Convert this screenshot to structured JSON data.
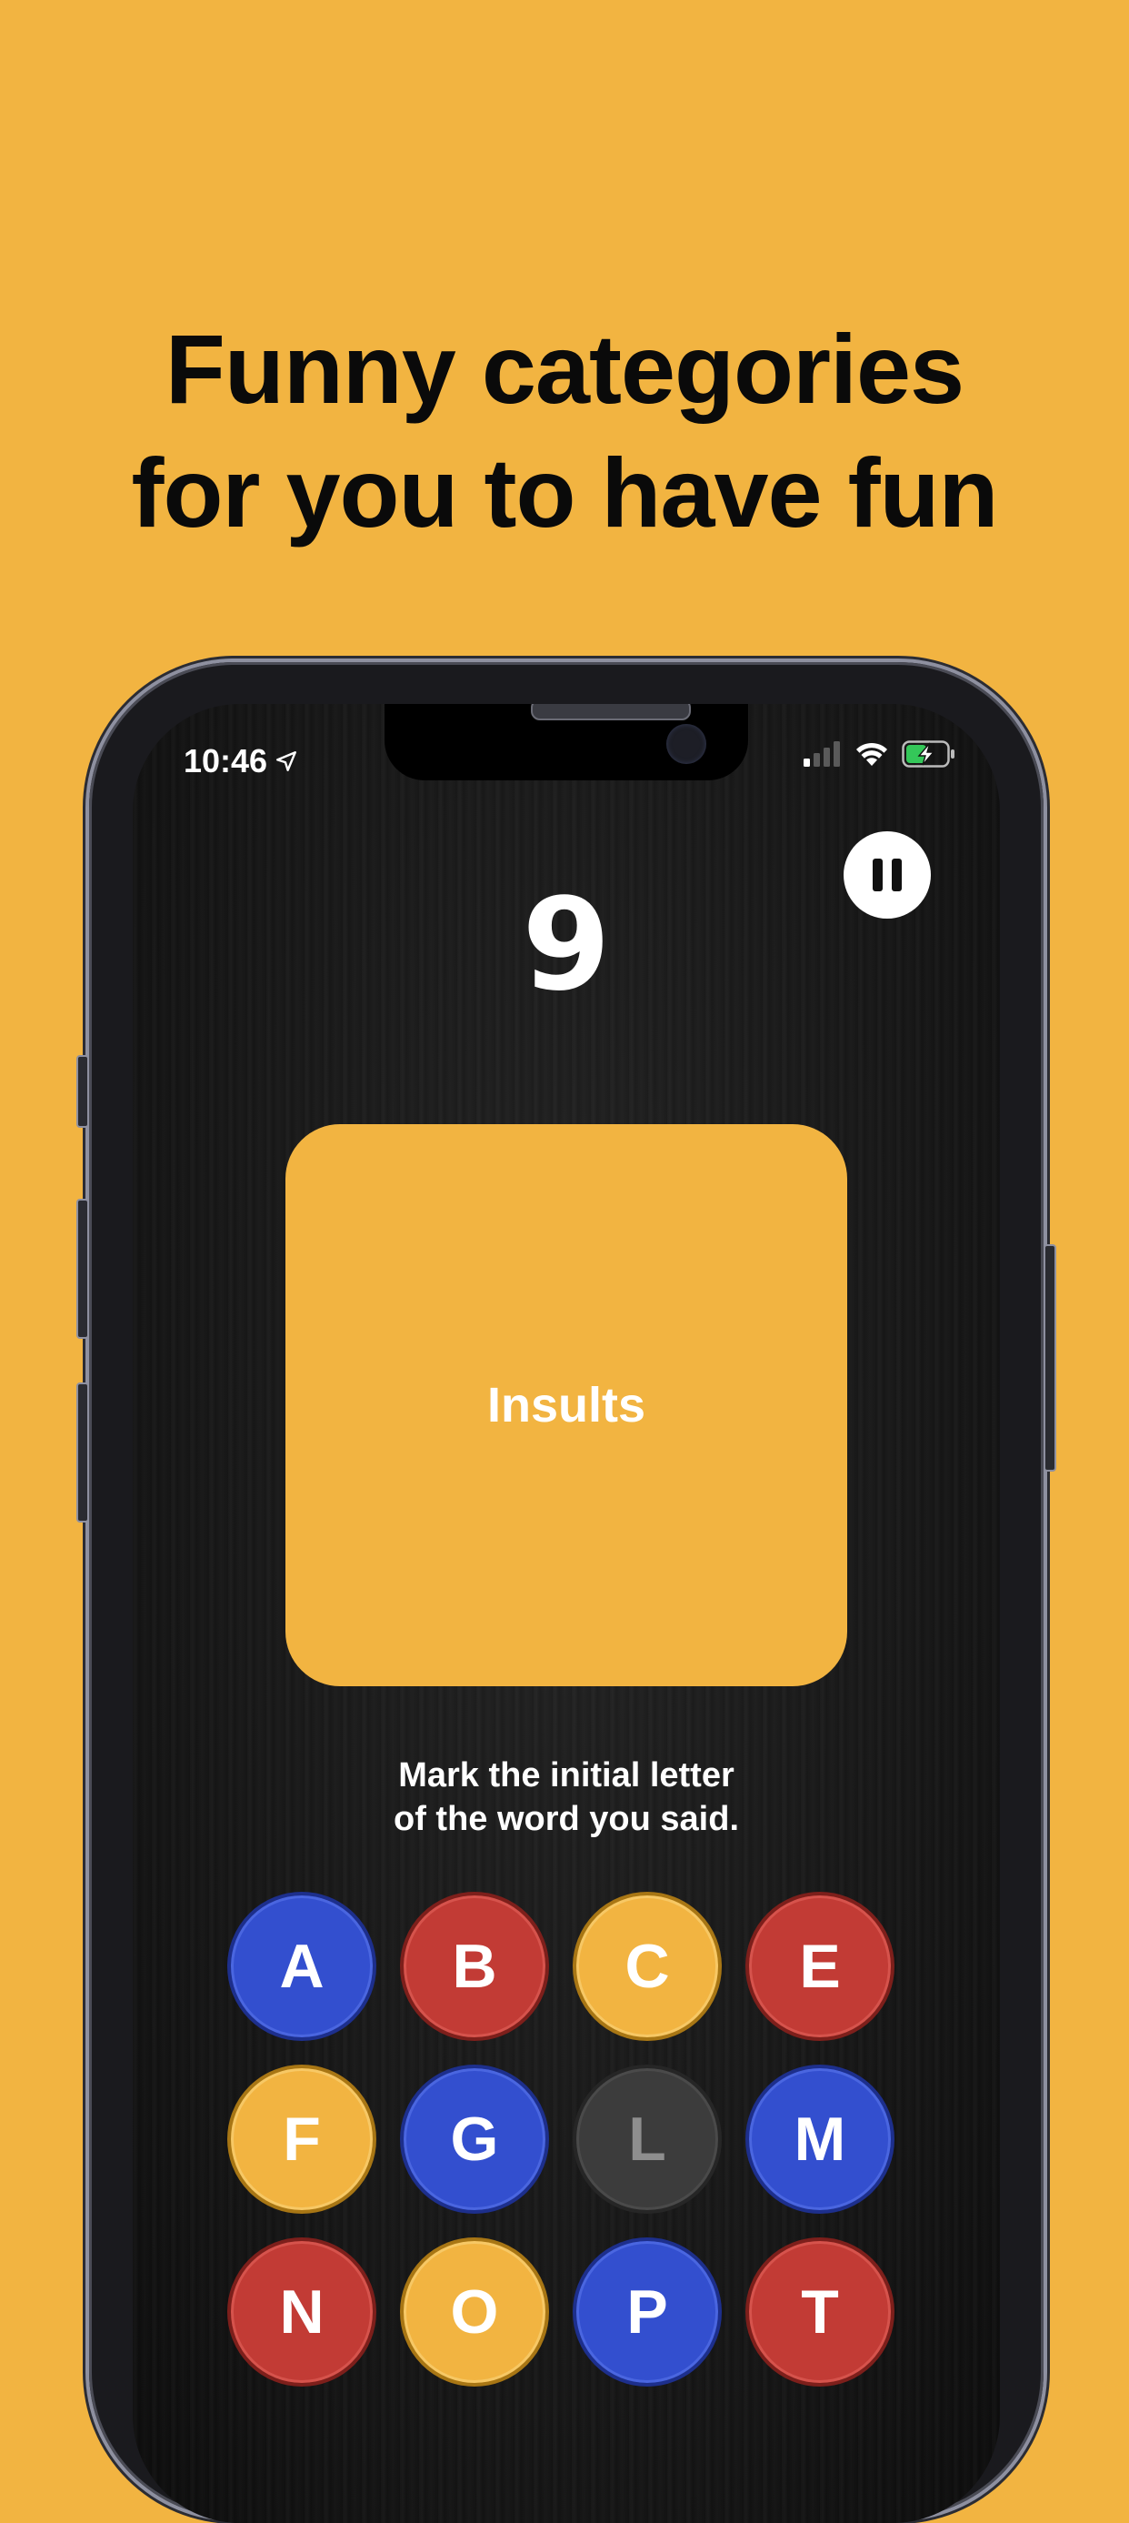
{
  "headline": {
    "line1": "Funny categories",
    "line2": "for you to have fun"
  },
  "status_bar": {
    "time": "10:46",
    "icons": [
      "location-arrow-icon",
      "signal-icon",
      "wifi-icon",
      "battery-charging-icon"
    ]
  },
  "game": {
    "timer": "9",
    "category": "Insults",
    "instruction_line1": "Mark the initial letter",
    "instruction_line2": "of the word you said.",
    "pause_icon": "pause-icon"
  },
  "letters": [
    {
      "letter": "A",
      "color": "#334FCF"
    },
    {
      "letter": "B",
      "color": "#C23B35"
    },
    {
      "letter": "C",
      "color": "#F2B441"
    },
    {
      "letter": "E",
      "color": "#C23B35"
    },
    {
      "letter": "F",
      "color": "#F2B441"
    },
    {
      "letter": "G",
      "color": "#334FCF"
    },
    {
      "letter": "L",
      "color": "#3C3C3C",
      "disabled": true
    },
    {
      "letter": "M",
      "color": "#334FCF"
    },
    {
      "letter": "N",
      "color": "#C23B35"
    },
    {
      "letter": "O",
      "color": "#F2B441"
    },
    {
      "letter": "P",
      "color": "#334FCF"
    },
    {
      "letter": "T",
      "color": "#C23B35"
    }
  ],
  "colors": {
    "background": "#F2B441",
    "card": "#F2B441",
    "blue": "#334FCF",
    "red": "#C23B35",
    "yellow": "#F2B441",
    "disabled": "#3C3C3C"
  }
}
